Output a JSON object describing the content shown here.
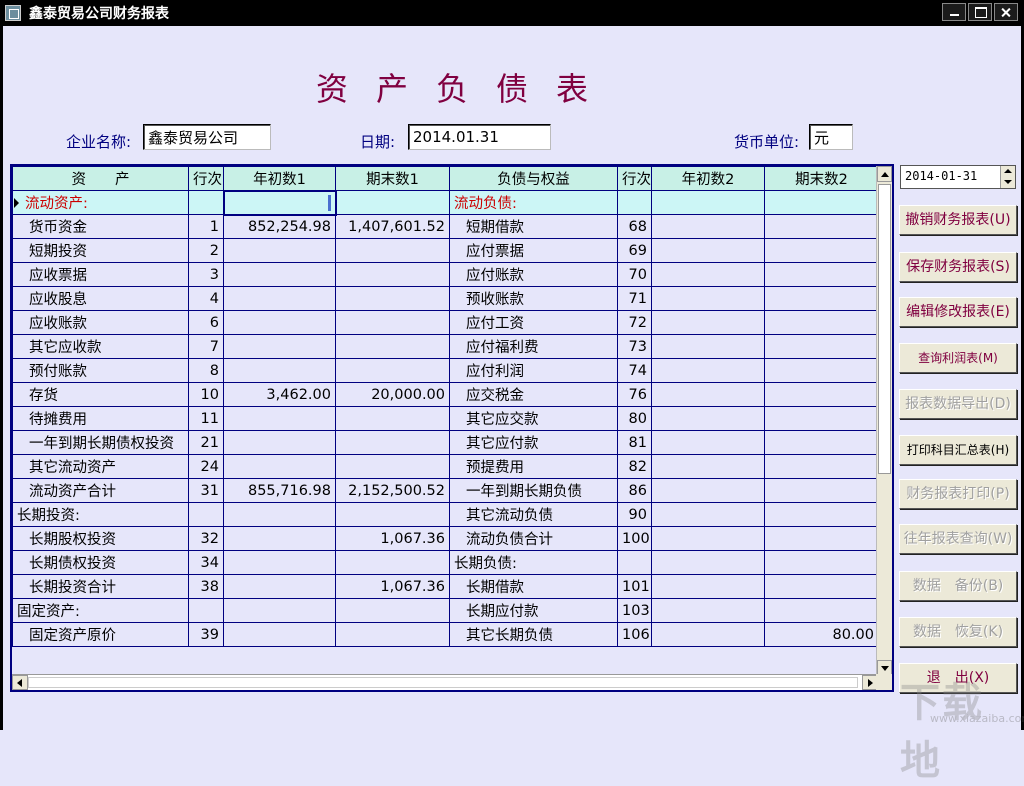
{
  "window": {
    "title": "鑫泰贸易公司财务报表"
  },
  "report": {
    "title": "资产负债表",
    "company_label": "企业名称:",
    "company_value": "鑫泰贸易公司",
    "date_label": "日期:",
    "date_value": "2014.01.31",
    "currency_label": "货币单位:",
    "currency_value": "元"
  },
  "grid": {
    "headers": [
      "资　　产",
      "行次",
      "年初数1",
      "期末数1",
      "负债与权益",
      "行次",
      "年初数2",
      "期末数2"
    ],
    "rows": [
      {
        "a": "流动资产:",
        "r1": "",
        "b1": "",
        "e1": "",
        "l": "流动负债:",
        "r2": "",
        "b2": "",
        "e2": ""
      },
      {
        "a": "货币资金",
        "r1": "1",
        "b1": "852,254.98",
        "e1": "1,407,601.52",
        "l": "短期借款",
        "r2": "68",
        "b2": "",
        "e2": ""
      },
      {
        "a": "短期投资",
        "r1": "2",
        "b1": "",
        "e1": "",
        "l": "应付票据",
        "r2": "69",
        "b2": "",
        "e2": ""
      },
      {
        "a": "应收票据",
        "r1": "3",
        "b1": "",
        "e1": "",
        "l": "应付账款",
        "r2": "70",
        "b2": "",
        "e2": ""
      },
      {
        "a": "应收股息",
        "r1": "4",
        "b1": "",
        "e1": "",
        "l": "预收账款",
        "r2": "71",
        "b2": "",
        "e2": ""
      },
      {
        "a": "应收账款",
        "r1": "6",
        "b1": "",
        "e1": "",
        "l": "应付工资",
        "r2": "72",
        "b2": "",
        "e2": ""
      },
      {
        "a": "其它应收款",
        "r1": "7",
        "b1": "",
        "e1": "",
        "l": "应付福利费",
        "r2": "73",
        "b2": "",
        "e2": ""
      },
      {
        "a": "预付账款",
        "r1": "8",
        "b1": "",
        "e1": "",
        "l": "应付利润",
        "r2": "74",
        "b2": "",
        "e2": ""
      },
      {
        "a": "存货",
        "r1": "10",
        "b1": "3,462.00",
        "e1": "20,000.00",
        "l": "应交税金",
        "r2": "76",
        "b2": "",
        "e2": ""
      },
      {
        "a": "待摊费用",
        "r1": "11",
        "b1": "",
        "e1": "",
        "l": "其它应交款",
        "r2": "80",
        "b2": "",
        "e2": ""
      },
      {
        "a": "一年到期长期债权投资",
        "r1": "21",
        "b1": "",
        "e1": "",
        "l": "其它应付款",
        "r2": "81",
        "b2": "",
        "e2": ""
      },
      {
        "a": "其它流动资产",
        "r1": "24",
        "b1": "",
        "e1": "",
        "l": "预提费用",
        "r2": "82",
        "b2": "",
        "e2": ""
      },
      {
        "a": "流动资产合计",
        "r1": "31",
        "b1": "855,716.98",
        "e1": "2,152,500.52",
        "l": "一年到期长期负债",
        "r2": "86",
        "b2": "",
        "e2": ""
      },
      {
        "a": "长期投资:",
        "r1": "",
        "b1": "",
        "e1": "",
        "l": "其它流动负债",
        "r2": "90",
        "b2": "",
        "e2": ""
      },
      {
        "a": "长期股权投资",
        "r1": "32",
        "b1": "",
        "e1": "1,067.36",
        "l": "流动负债合计",
        "r2": "100",
        "b2": "",
        "e2": ""
      },
      {
        "a": "长期债权投资",
        "r1": "34",
        "b1": "",
        "e1": "",
        "l": "长期负债:",
        "r2": "",
        "b2": "",
        "e2": ""
      },
      {
        "a": "长期投资合计",
        "r1": "38",
        "b1": "",
        "e1": "1,067.36",
        "l": "长期借款",
        "r2": "101",
        "b2": "",
        "e2": ""
      },
      {
        "a": "固定资产:",
        "r1": "",
        "b1": "",
        "e1": "",
        "l": "长期应付款",
        "r2": "103",
        "b2": "",
        "e2": ""
      },
      {
        "a": "固定资产原价",
        "r1": "39",
        "b1": "",
        "e1": "",
        "l": "其它长期负债",
        "r2": "106",
        "b2": "",
        "e2": "80.00"
      }
    ]
  },
  "side": {
    "date_spinner": "2014-01-31",
    "buttons": [
      {
        "label": "撤销财务报表(U)",
        "name": "cancel-report-button"
      },
      {
        "label": "保存财务报表(S)",
        "name": "save-report-button"
      },
      {
        "label": "编辑修改报表(E)",
        "name": "edit-report-button"
      },
      {
        "label": "查询利润表(M)",
        "name": "query-profit-button"
      },
      {
        "label": "报表数据导出(D)",
        "name": "export-data-button"
      },
      {
        "label": "打印科目汇总表(H)",
        "name": "print-summary-button"
      },
      {
        "label": "财务报表打印(P)",
        "name": "print-report-button"
      },
      {
        "label": "往年报表查询(W)",
        "name": "past-reports-button"
      },
      {
        "label": "数据　备份(B)",
        "name": "backup-button"
      },
      {
        "label": "数据　恢复(K)",
        "name": "restore-button"
      },
      {
        "label": "退　出(X)",
        "name": "exit-button"
      }
    ]
  },
  "watermark": {
    "big": "下载地",
    "small": "www.xiazaiba.com"
  }
}
